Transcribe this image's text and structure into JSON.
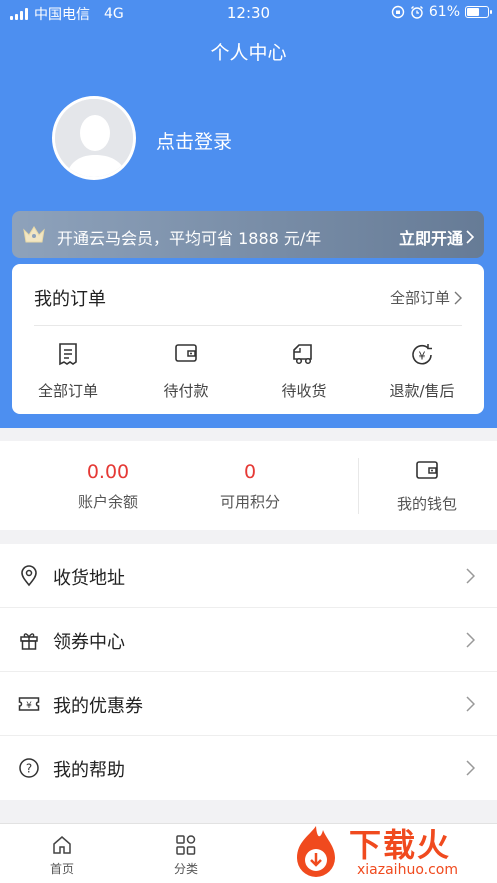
{
  "status_bar": {
    "carrier": "中国电信",
    "network": "4G",
    "time": "12:30",
    "battery": "61%",
    "battery_level": 0.61
  },
  "header": {
    "title": "个人中心",
    "login_text": "点击登录"
  },
  "vip": {
    "text": "开通云马会员，平均可省 1888 元/年",
    "button": "立即开通"
  },
  "orders": {
    "title": "我的订单",
    "all_link": "全部订单",
    "items": [
      {
        "label": "全部订单",
        "icon": "order-list-icon"
      },
      {
        "label": "待付款",
        "icon": "wallet-icon"
      },
      {
        "label": "待收货",
        "icon": "truck-icon"
      },
      {
        "label": "退款/售后",
        "icon": "refund-icon"
      }
    ]
  },
  "stats": {
    "balance": {
      "value": "0.00",
      "label": "账户余额"
    },
    "points": {
      "value": "0",
      "label": "可用积分"
    },
    "wallet": {
      "label": "我的钱包"
    }
  },
  "menu": [
    {
      "label": "收货地址",
      "icon": "location-icon"
    },
    {
      "label": "领券中心",
      "icon": "gift-icon"
    },
    {
      "label": "我的优惠券",
      "icon": "coupon-icon"
    },
    {
      "label": "我的帮助",
      "icon": "help-icon"
    }
  ],
  "tabbar": [
    {
      "label": "首页",
      "icon": "home-icon"
    },
    {
      "label": "分类",
      "icon": "category-icon"
    }
  ],
  "watermark": {
    "text": "下载火",
    "sub": "xiazaihuo.com"
  },
  "colors": {
    "primary": "#4d8ff0",
    "price": "#e53935",
    "vip_start": "#8ea2bb",
    "vip_end": "#667b96",
    "watermark": "#f04a1e"
  }
}
